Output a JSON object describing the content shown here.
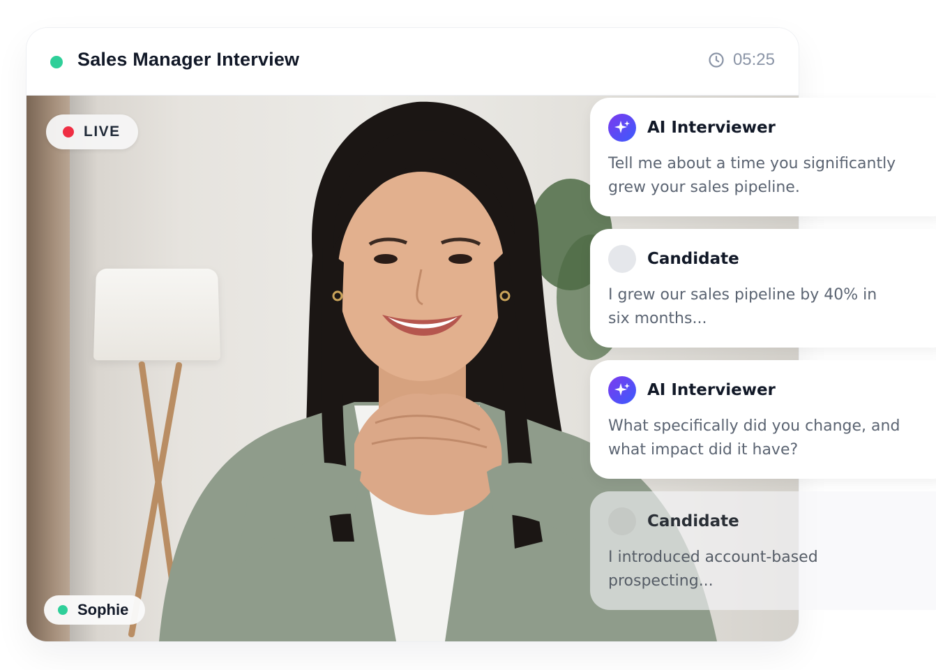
{
  "header": {
    "title": "Sales Manager Interview",
    "timer": "05:25",
    "status_color": "#2fcf99"
  },
  "video": {
    "live_label": "LIVE",
    "participant_name": "Sophie",
    "live_color": "#ef2e43"
  },
  "chat": [
    {
      "speaker": "AI Interviewer",
      "role": "ai",
      "message": "Tell me about a time you significantly grew your sales pipeline."
    },
    {
      "speaker": "Candidate",
      "role": "candidate",
      "message": "I grew our sales pipeline by 40% in six months..."
    },
    {
      "speaker": "AI Interviewer",
      "role": "ai",
      "message": "What specifically did you change, and what impact did it have?"
    },
    {
      "speaker": "Candidate",
      "role": "candidate",
      "message": "I introduced account-based prospecting..."
    }
  ],
  "icons": {
    "timer": "clock-icon",
    "ai_avatar": "sparkle-icon"
  }
}
